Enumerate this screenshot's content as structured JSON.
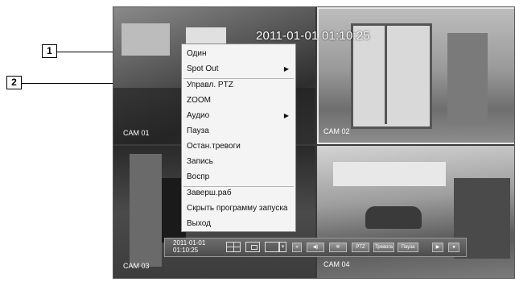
{
  "osd": {
    "datetime": "2011-01-01 01:10:25"
  },
  "cameras": [
    "CAM 01",
    "CAM 02",
    "CAM 03",
    "CAM 04"
  ],
  "callouts": [
    "1",
    "2"
  ],
  "context_menu": {
    "items": [
      {
        "label": "Один",
        "submenu": false
      },
      {
        "label": "Spot Out",
        "submenu": true
      },
      {
        "label": "Управл. PTZ",
        "submenu": false
      },
      {
        "label": "ZOOM",
        "submenu": false
      },
      {
        "label": "Аудио",
        "submenu": true
      },
      {
        "label": "Пауза",
        "submenu": false
      },
      {
        "label": "Остан.тревоги",
        "submenu": false
      },
      {
        "label": "Запись",
        "submenu": false
      },
      {
        "label": "Воспр",
        "submenu": false
      },
      {
        "label": "Заверш.раб",
        "submenu": false
      },
      {
        "label": "Скрыть программу запуска",
        "submenu": false
      },
      {
        "label": "Выход",
        "submenu": false
      }
    ],
    "submenu_arrow": "▶"
  },
  "toolbar": {
    "date": "2011-01-01",
    "time": "01:10:25",
    "collapse_label": "«",
    "audio_icon": "speaker-icon",
    "settings_icon": "gear-icon",
    "ptz_label": "PTZ",
    "alarm_label": "Тревога",
    "pause_label": "Пауза",
    "play_icon": "play-icon",
    "record_icon": "record-icon"
  }
}
